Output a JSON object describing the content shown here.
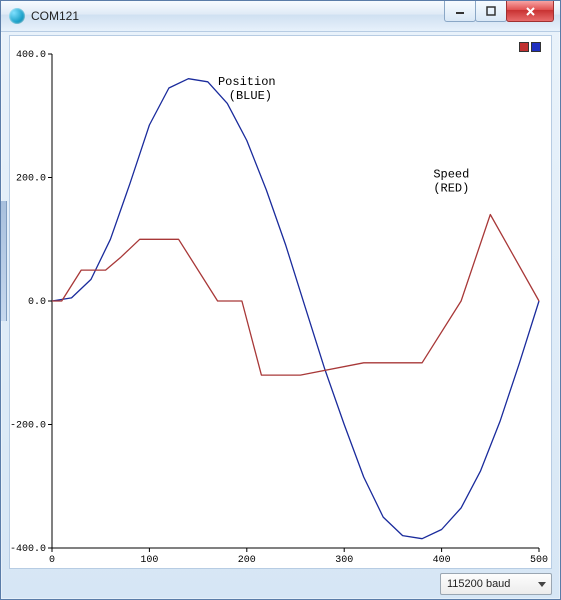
{
  "window": {
    "title": "COM121",
    "buttons": {
      "min": "–",
      "max": "☐",
      "close": "✕"
    }
  },
  "legend": {
    "swatches": [
      "red",
      "blue"
    ]
  },
  "status": {
    "baud": "115200 baud"
  },
  "chart_data": {
    "type": "line",
    "xlabel": "",
    "ylabel": "",
    "xlim": [
      0,
      500
    ],
    "ylim": [
      -400,
      400
    ],
    "xticks": [
      0,
      100,
      200,
      300,
      400,
      500
    ],
    "yticks": [
      -400,
      -200,
      0,
      200,
      400
    ],
    "annotations": [
      {
        "text": "Position\n (BLUE)",
        "x": 200,
        "y": 350
      },
      {
        "text": "Speed\n(RED)",
        "x": 410,
        "y": 200
      }
    ],
    "series": [
      {
        "name": "Position (BLUE)",
        "color": "#1a2b9c",
        "x": [
          0,
          20,
          40,
          60,
          80,
          100,
          120,
          140,
          160,
          180,
          200,
          220,
          240,
          260,
          280,
          300,
          320,
          340,
          360,
          380,
          400,
          420,
          440,
          460,
          480,
          500
        ],
        "y": [
          0,
          5,
          35,
          100,
          190,
          285,
          345,
          360,
          355,
          320,
          260,
          180,
          90,
          -10,
          -110,
          -200,
          -285,
          -350,
          -380,
          -385,
          -370,
          -335,
          -275,
          -195,
          -100,
          0
        ]
      },
      {
        "name": "Speed (RED)",
        "color": "#a83838",
        "x": [
          0,
          10,
          30,
          55,
          70,
          90,
          130,
          170,
          195,
          215,
          255,
          320,
          380,
          420,
          450,
          500
        ],
        "y": [
          0,
          0,
          50,
          50,
          70,
          100,
          100,
          0,
          0,
          -120,
          -120,
          -100,
          -100,
          0,
          140,
          0
        ]
      }
    ]
  }
}
